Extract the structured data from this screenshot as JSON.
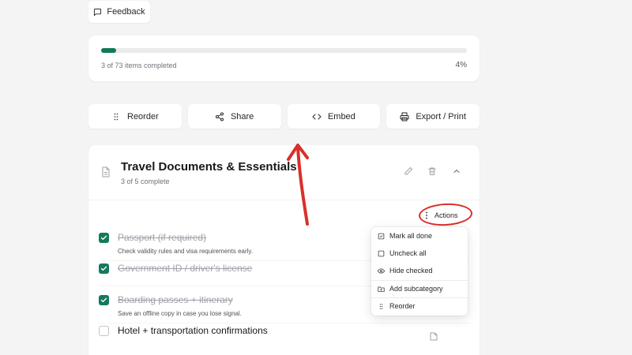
{
  "feedback": {
    "label": "Feedback",
    "icon": "message-square-icon"
  },
  "progress": {
    "completed": 3,
    "total": 73,
    "label": "3 of 73 items completed",
    "percent_label": "4%",
    "percent": 4,
    "color": "#0f7a5a"
  },
  "toolbar": {
    "reorder": "Reorder",
    "share": "Share",
    "embed": "Embed",
    "export": "Export / Print"
  },
  "section": {
    "title": "Travel Documents & Essentials",
    "subtitle": "3 of 5 complete",
    "actions_label": "Actions",
    "items": [
      {
        "title": "Passport (if required)",
        "note": "Check validity rules and visa requirements early.",
        "checked": true
      },
      {
        "title": "Government ID / driver's license",
        "note": "",
        "checked": true
      },
      {
        "title": "Boarding passes + itinerary",
        "note": "Save an offline copy in case you lose signal.",
        "checked": true
      },
      {
        "title": "Hotel + transportation confirmations",
        "note": "",
        "checked": false
      }
    ]
  },
  "menu": {
    "items": [
      {
        "label": "Mark all done",
        "icon": "square-check-icon"
      },
      {
        "label": "Uncheck all",
        "icon": "square-icon"
      },
      {
        "label": "Hide checked",
        "icon": "eye-icon"
      },
      {
        "label": "Add subcategory",
        "icon": "folder-plus-icon"
      },
      {
        "label": "Reorder",
        "icon": "grip-icon"
      }
    ]
  },
  "annotation": {
    "color": "#d8302a"
  }
}
